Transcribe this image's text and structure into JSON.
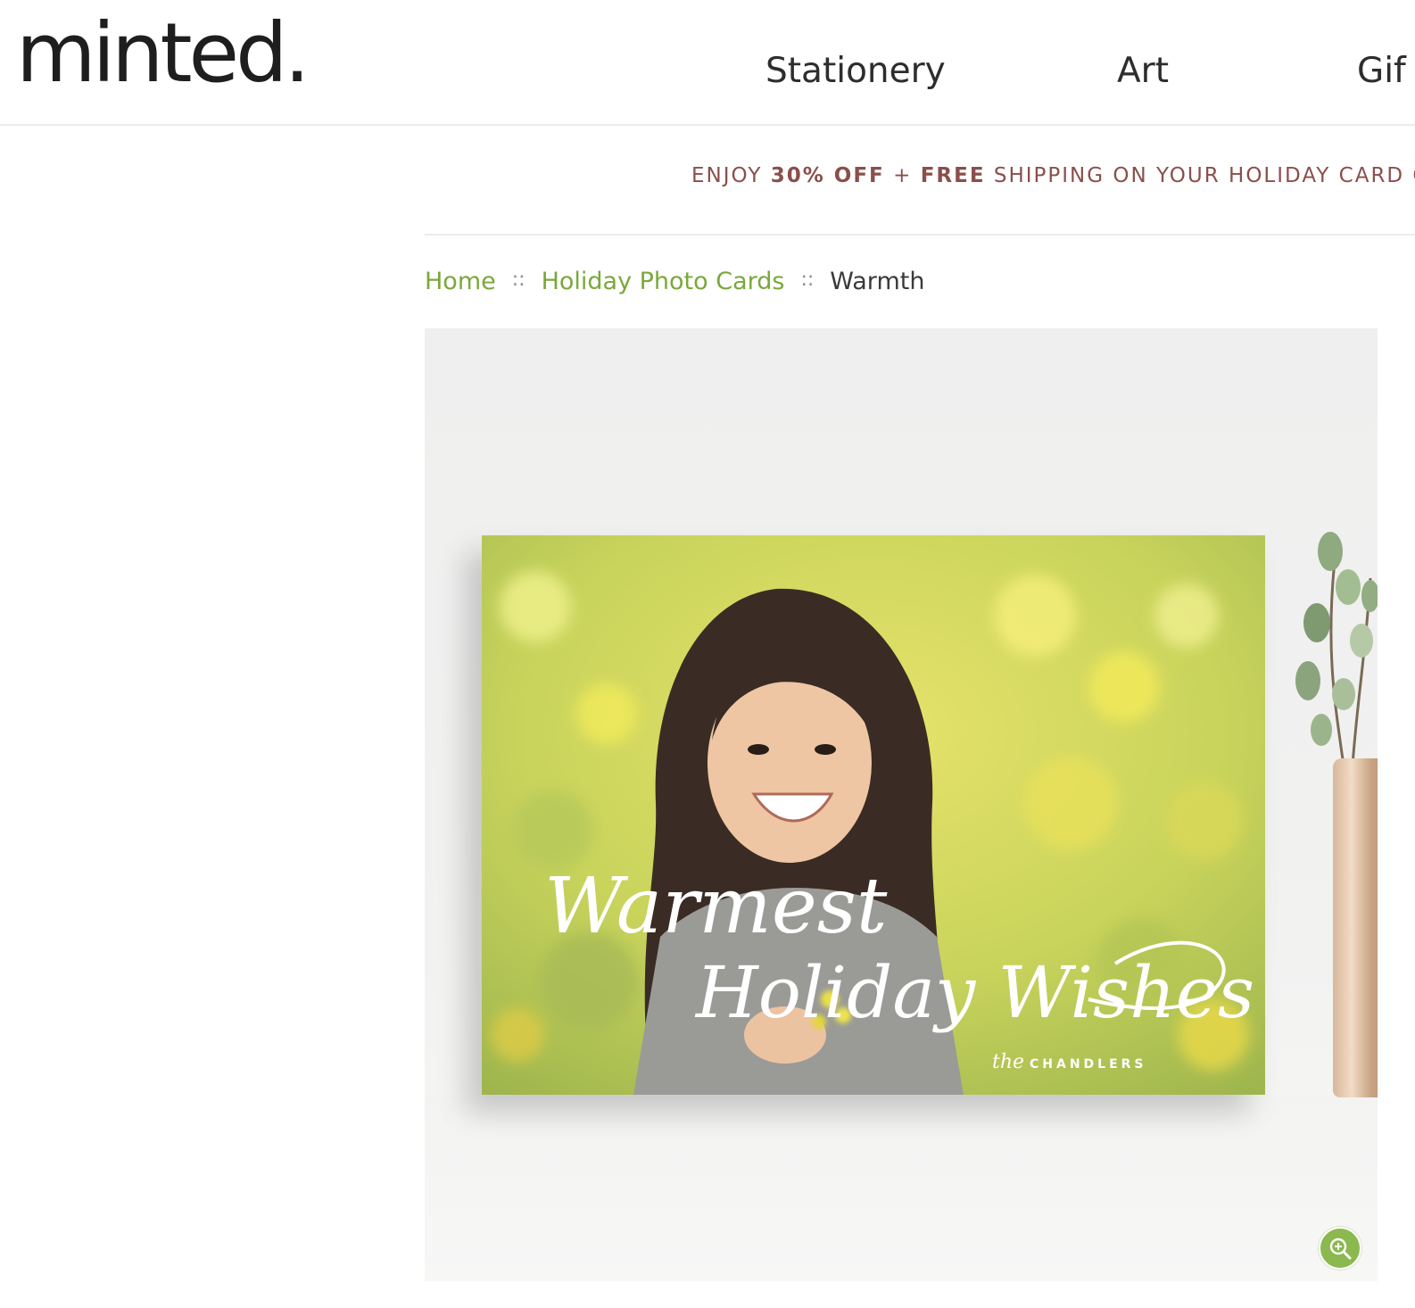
{
  "header": {
    "logo_text": "minted.",
    "nav": [
      {
        "label": "Stationery"
      },
      {
        "label": "Art"
      },
      {
        "label": "Gif"
      }
    ]
  },
  "promo": {
    "part1": "ENJOY ",
    "discount": "30% OFF",
    "part2": " + ",
    "free": "FREE",
    "part3": " SHIPPING ON YOUR HOLIDAY CARD OR"
  },
  "breadcrumb": {
    "items": [
      {
        "label": "Home"
      },
      {
        "label": "Holiday Photo Cards"
      }
    ],
    "separator": "::",
    "current": "Warmth"
  },
  "product": {
    "card_greeting_line1": "Warmest",
    "card_greeting_line2": "Holiday Wishes",
    "card_signature_prefix": "the",
    "card_signature_name": "CHANDLERS"
  },
  "colors": {
    "link_green": "#7aa83a",
    "promo_text": "#8a4f4b",
    "zoom_green": "#8bb84f"
  },
  "icons": {
    "zoom": "zoom-in-icon"
  }
}
